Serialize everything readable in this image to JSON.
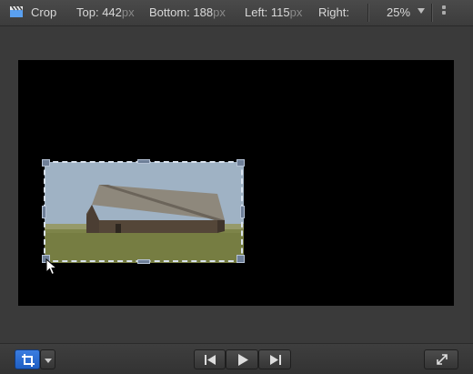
{
  "toolbar": {
    "tool_icon": "clapperboard-icon",
    "tool_label": "Crop",
    "top": {
      "label": "Top:",
      "value": "442",
      "unit": "px"
    },
    "bottom": {
      "label": "Bottom:",
      "value": "188",
      "unit": "px"
    },
    "left": {
      "label": "Left:",
      "value": "115",
      "unit": "px"
    },
    "right": {
      "label": "Right:"
    },
    "zoom": "25%"
  },
  "transport": {
    "prev_icon": "skip-back-icon",
    "play_icon": "play-icon",
    "next_icon": "skip-forward-icon"
  },
  "colors": {
    "accent": "#2d6fd6",
    "canvas": "#000000",
    "chrome": "#3a3a3a",
    "crop_handle": "#6e7f98"
  }
}
